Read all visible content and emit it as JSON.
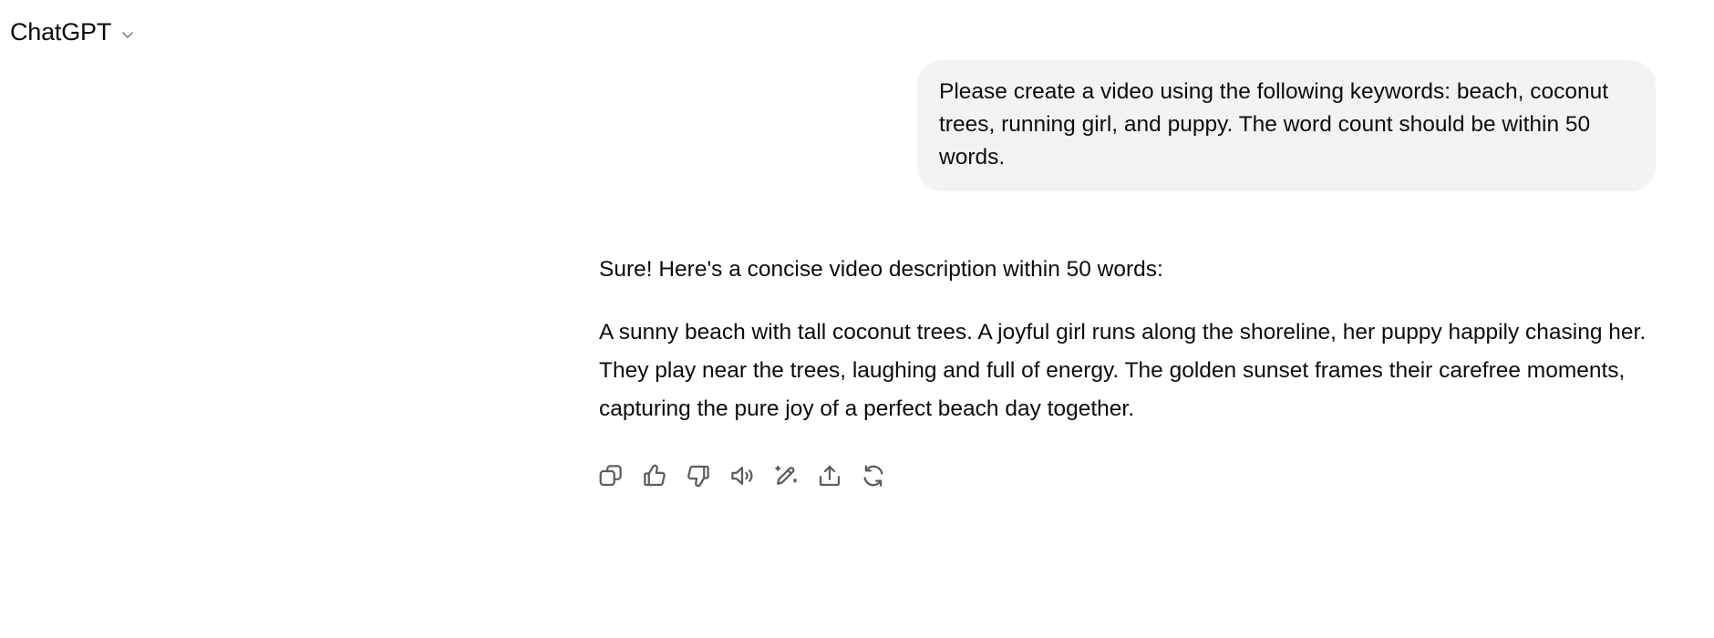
{
  "header": {
    "model_name": "ChatGPT",
    "chevron_icon": "chevron-down-icon"
  },
  "conversation": {
    "user_message": "Please create a video using the following keywords: beach, coconut trees, running girl, and puppy. The word count should be within 50 words.",
    "assistant_intro": "Sure! Here's a concise video description within 50 words:",
    "assistant_body": "A sunny beach with tall coconut trees. A joyful girl runs along the shoreline, her puppy happily chasing her. They play near the trees, laughing and full of energy. The golden sunset frames their carefree moments, capturing the pure joy of a perfect beach day together."
  },
  "actions": {
    "icons": [
      "copy-icon",
      "thumbs-up-icon",
      "thumbs-down-icon",
      "read-aloud-icon",
      "edit-icon",
      "share-icon",
      "regenerate-icon"
    ]
  },
  "colors": {
    "user_bubble_bg": "#f3f3f3",
    "text": "#0d0d0d",
    "icon": "#5d5d5d"
  }
}
